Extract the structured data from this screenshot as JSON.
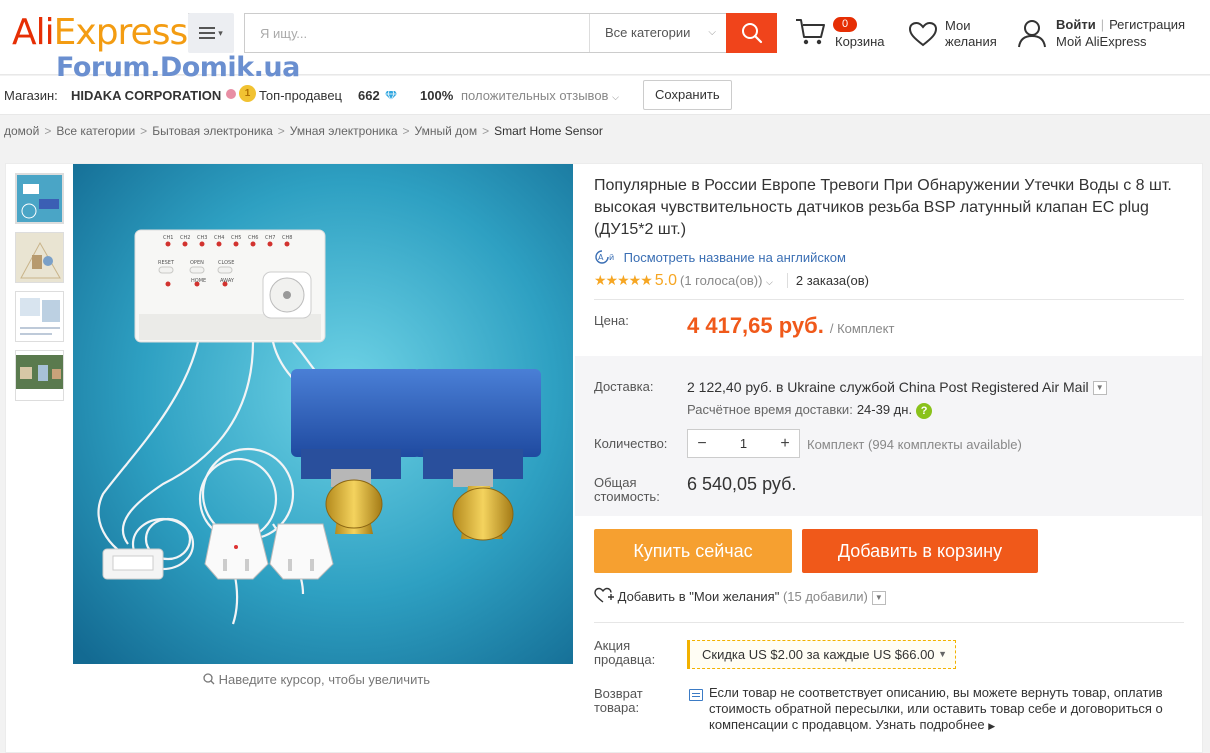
{
  "header": {
    "logo_part1": "Ali",
    "logo_part2": "Express",
    "logo_tm": "™",
    "watermark": "Forum.Domik.ua",
    "search_placeholder": "Я ищу...",
    "category_select": "Все категории",
    "cart_count": "0",
    "cart_label": "Корзина",
    "wishlist_line1": "Мои",
    "wishlist_line2": "желания",
    "login": "Войти",
    "register": "Регистрация",
    "my_account": "Мой AliExpress",
    "brand_color": "#e62e04"
  },
  "store": {
    "label": "Магазин:",
    "name": "HIDAKA CORPORATION",
    "top_seller": "Топ-продавец",
    "score": "662",
    "positive_pct": "100%",
    "positive_label": "положительных отзывов",
    "save_button": "Сохранить"
  },
  "breadcrumb": [
    "домой",
    "Все категории",
    "Бытовая электроника",
    "Умная электроника",
    "Умный дом",
    "Smart Home Sensor"
  ],
  "gallery": {
    "zoom_hint": "Наведите курсор, чтобы увеличить",
    "device_buttons": [
      "RESET",
      "OPEN",
      "CLOSE",
      "HOME",
      "AWAY"
    ],
    "channels": [
      "CH1",
      "CH2",
      "CH3",
      "CH4",
      "CH5",
      "CH6",
      "CH7",
      "CH8"
    ]
  },
  "product": {
    "title": "Популярные в России Европе Тревоги При Обнаружении Утечки Воды с 8 шт. высокая чувствительность датчиков резьба BSP латунный клапан EC plug (ДУ15*2 шт.)",
    "translate_link": "Посмотреть название на английском",
    "stars": "★★★★★",
    "rating": "5.0",
    "votes": "(1 голоса(ов))",
    "orders": "2 заказа(ов)",
    "price_label": "Цена:",
    "price": "4 417,65 руб.",
    "price_unit": "/ Комплект",
    "delivery_label": "Доставка:",
    "delivery_price": "2 122,40 руб.",
    "delivery_to": "в Ukraine службой China Post Registered Air Mail",
    "eta_label": "Расчётное время доставки:",
    "eta_days": "24-39 дн.",
    "qty_label": "Количество:",
    "qty_value": "1",
    "qty_available": "Комплект (994 комплекты available)",
    "total_label_1": "Общая",
    "total_label_2": "стоимость:",
    "total": "6 540,05 руб.",
    "buy_now": "Купить сейчас",
    "add_to_cart": "Добавить в корзину",
    "wishlist_add": "Добавить в \"Мои желания\"",
    "wishlist_count": "(15 добавили)",
    "promo_label_1": "Акция",
    "promo_label_2": "продавца:",
    "promo_discount": "Скидка",
    "promo_amount": "US $2.00",
    "promo_each": "за каждые",
    "promo_threshold": "US $66.00",
    "return_label_1": "Возврат",
    "return_label_2": "товара:",
    "return_text": "Если товар не соответствует описанию, вы можете вернуть товар, оплатив стоимость обратной пересылки, или оставить товар себе и договориться о компенсации с продавцом.",
    "return_more": "Узнать подробнее",
    "accent_color": "#f0591a"
  }
}
